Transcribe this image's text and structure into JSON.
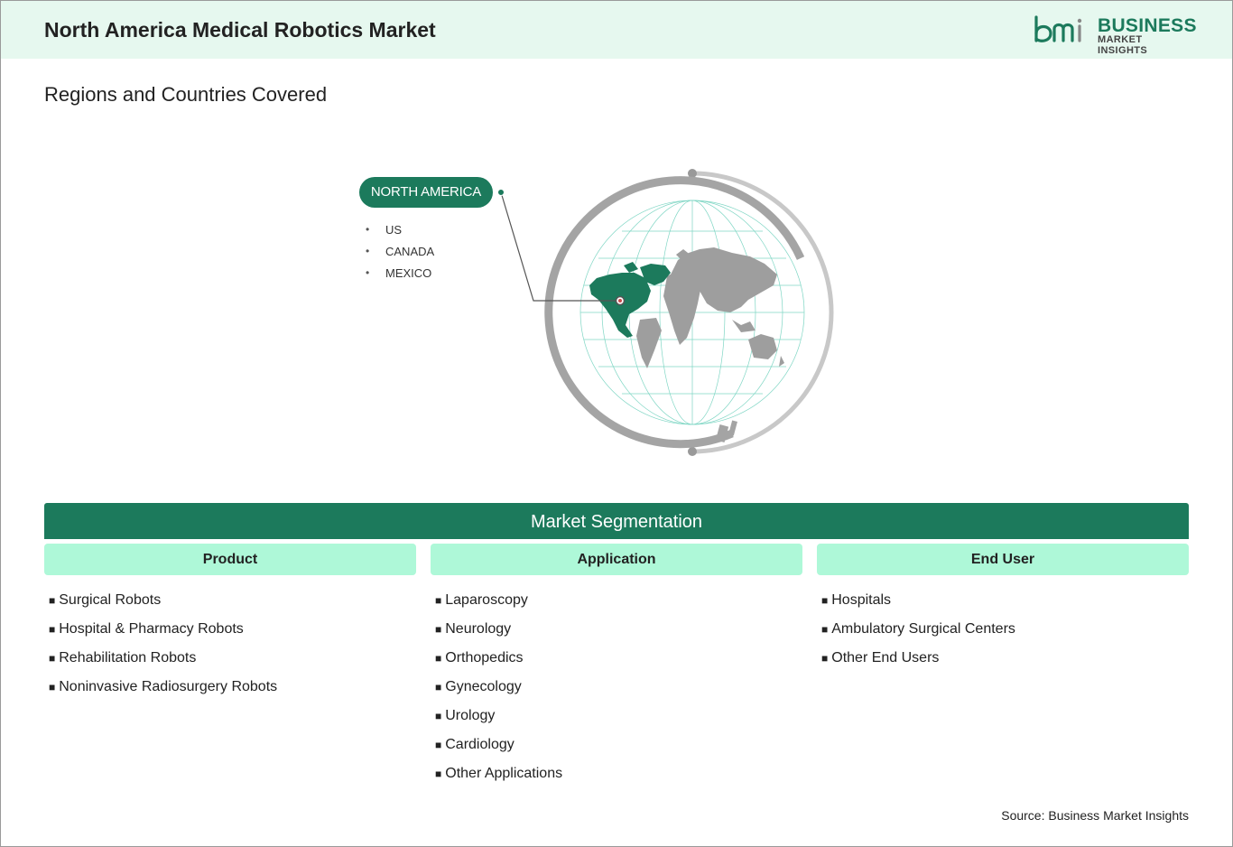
{
  "header": {
    "title": "North America Medical Robotics Market",
    "logo": {
      "mark": "bmi",
      "line1": "BUSINESS",
      "line2": "MARKET INSIGHTS",
      "color": "#1c7a5c"
    }
  },
  "regions": {
    "heading": "Regions and Countries Covered",
    "region_label": "NORTH AMERICA",
    "countries": [
      "US",
      "CANADA",
      "MEXICO"
    ],
    "highlight_color": "#1c7a5c"
  },
  "segmentation": {
    "title": "Market Segmentation",
    "columns": [
      {
        "heading": "Product",
        "items": [
          "Surgical Robots",
          "Hospital & Pharmacy Robots",
          "Rehabilitation Robots",
          "Noninvasive Radiosurgery Robots"
        ]
      },
      {
        "heading": "Application",
        "items": [
          "Laparoscopy",
          "Neurology",
          "Orthopedics",
          "Gynecology",
          "Urology",
          "Cardiology",
          "Other Applications"
        ]
      },
      {
        "heading": "End User",
        "items": [
          "Hospitals",
          "Ambulatory Surgical Centers",
          "Other End Users"
        ]
      }
    ]
  },
  "footer": {
    "source": "Source: Business Market Insights"
  }
}
